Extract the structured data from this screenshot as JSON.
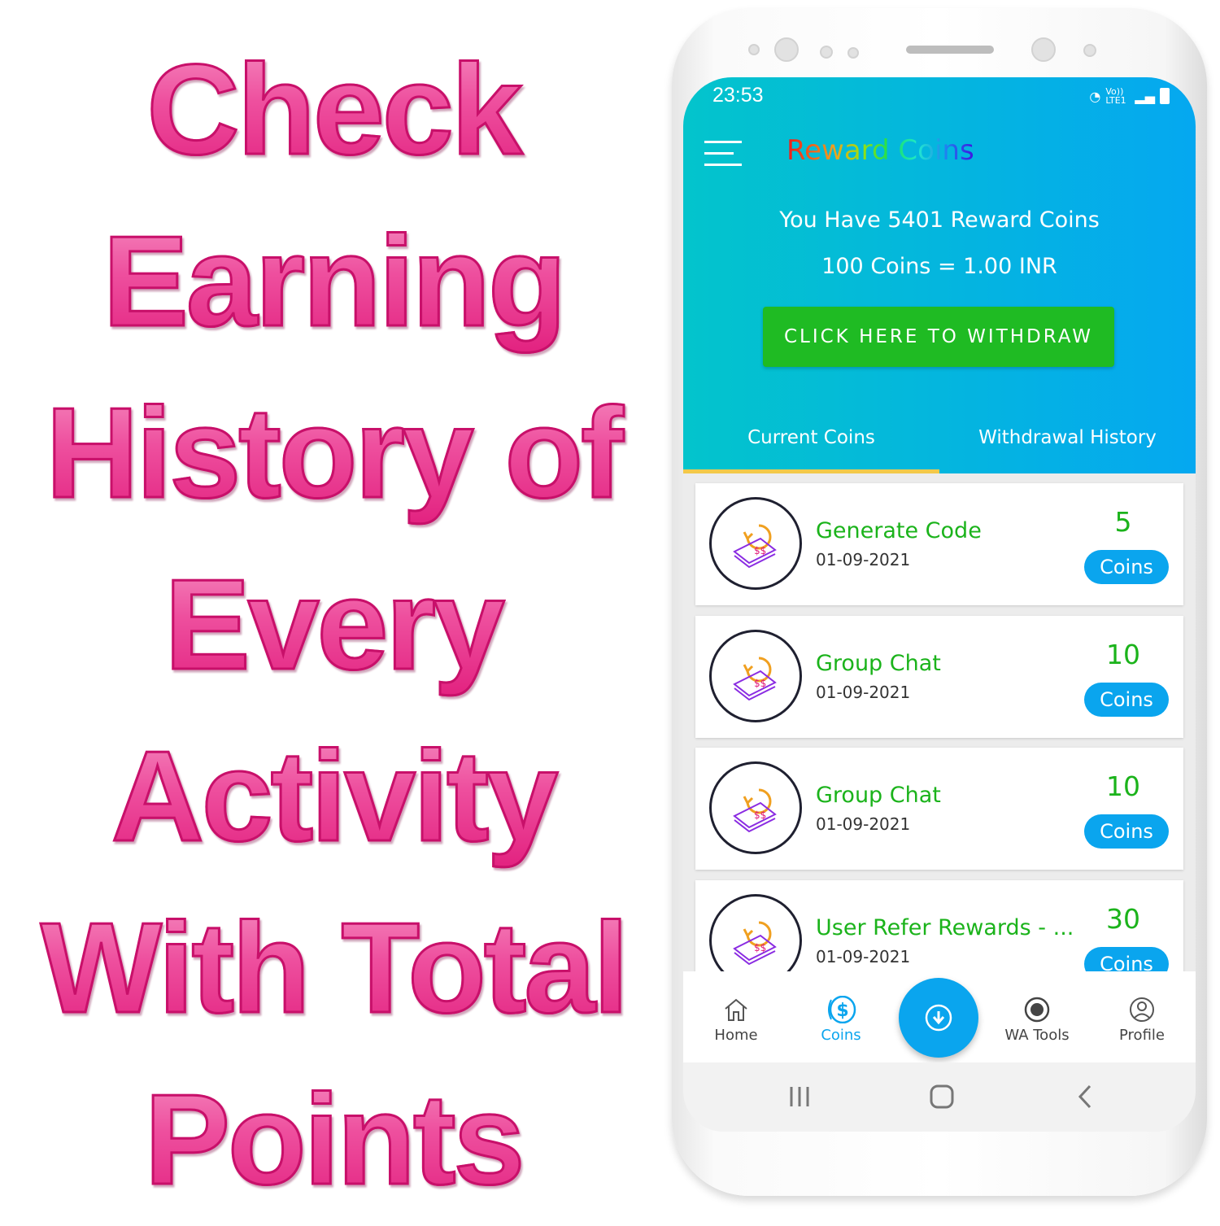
{
  "headline": {
    "lines": [
      "Check",
      "Earning",
      "History of",
      "Every",
      "Activity",
      "With Total",
      "Points"
    ]
  },
  "status_bar": {
    "time": "23:53",
    "network": "Vo)) LTE1"
  },
  "app_bar": {
    "title": "Reward Coins",
    "menu_icon": "hamburger-icon"
  },
  "summary": {
    "balance_text": "You Have 5401 Reward Coins",
    "rate_text": "100 Coins = 1.00 INR",
    "withdraw_label": "CLICK HERE TO WITHDRAW"
  },
  "tabs": [
    {
      "label": "Current Coins",
      "active": true
    },
    {
      "label": "Withdrawal History",
      "active": false
    }
  ],
  "activities": [
    {
      "title": "Generate Code",
      "date": "01-09-2021",
      "amount": "5",
      "unit": "Coins"
    },
    {
      "title": "Group Chat",
      "date": "01-09-2021",
      "amount": "10",
      "unit": "Coins"
    },
    {
      "title": "Group Chat",
      "date": "01-09-2021",
      "amount": "10",
      "unit": "Coins"
    },
    {
      "title": "User Refer Rewards - ...",
      "date": "01-09-2021",
      "amount": "30",
      "unit": "Coins"
    }
  ],
  "bottom_nav": [
    {
      "label": "Home",
      "icon": "home-icon"
    },
    {
      "label": "Coins",
      "icon": "dollar-coin-icon",
      "active": true
    },
    {
      "label": "WA Tools",
      "icon": "whatsapp-icon"
    },
    {
      "label": "Profile",
      "icon": "user-icon"
    }
  ],
  "colors": {
    "accent": "#0aa5ee",
    "green": "#1fbb23",
    "headline_pink": "#e0197a",
    "tab_indicator": "#f3c94a"
  }
}
